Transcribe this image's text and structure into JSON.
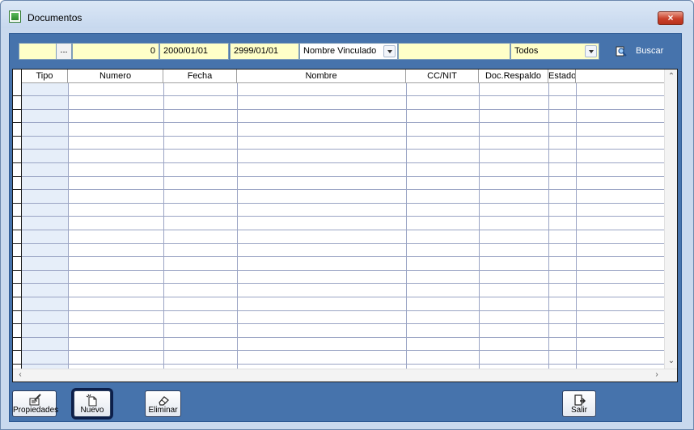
{
  "window": {
    "title": "Documentos",
    "close_label": "×"
  },
  "filters": {
    "code_value": "",
    "dots_label": "...",
    "number_value": "0",
    "date_from": "2000/01/01",
    "date_to": "2999/01/01",
    "filter_type_selected": "Nombre Vinculado",
    "filter_text_value": "",
    "status_selected": "Todos",
    "search_label": "Buscar"
  },
  "grid": {
    "columns": [
      "Tipo",
      "Numero",
      "Fecha",
      "Nombre",
      "CC/NIT",
      "Doc.Respaldo",
      "Estado"
    ],
    "rows": []
  },
  "buttons": {
    "properties": "Propiedades",
    "new": "Nuevo",
    "delete": "Eliminar",
    "exit": "Salir"
  },
  "colors": {
    "client_bg": "#4673ac",
    "field_bg": "#ffffc8",
    "tipo_col_bg": "#e6eef9"
  }
}
